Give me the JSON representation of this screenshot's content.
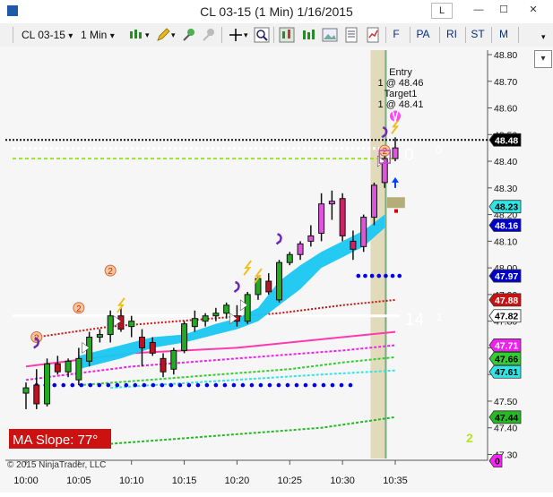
{
  "window": {
    "title": "CL 03-15 (1 Min)  1/16/2015",
    "btn_l": "L",
    "btn_min": "—",
    "btn_max": "☐",
    "btn_close": "✕"
  },
  "toolbar": {
    "instrument": "CL 03-15",
    "interval": "1 Min",
    "dropdown_glyph": "▾",
    "buttons": [
      "F",
      "PA",
      "RI",
      "ST",
      "M"
    ]
  },
  "chart": {
    "copyright": "© 2015 NinjaTrader, LLC",
    "ma_slope": "MA Slope:  77°",
    "label_14": "14",
    "label_1": "1",
    "label_0_big": "0",
    "label_0_small": "0",
    "label_2_green": "2",
    "entry_label": "Entry",
    "entry_qty": "1 @ 48.46",
    "target_label": "Target1",
    "target_qty": "1 @ 48.41",
    "circle_digit": "2",
    "axis_tick_labels": [
      "48.80",
      "48.70",
      "48.60",
      "48.50",
      "48.40",
      "48.30",
      "48.20",
      "48.10",
      "48.00",
      "47.90",
      "47.80",
      "47.70",
      "47.60",
      "47.50",
      "47.40",
      "47.30"
    ],
    "time_labels": [
      "10:00",
      "10:05",
      "10:10",
      "10:15",
      "10:20",
      "10:25",
      "10:30",
      "10:35"
    ],
    "price_badges": [
      {
        "text": "48.48",
        "bg": "#000000",
        "fg": "#ffffff"
      },
      {
        "text": "48.23",
        "bg": "#2ee6e6",
        "fg": "#000000"
      },
      {
        "text": "48.16",
        "bg": "#0000cc",
        "fg": "#ffffff"
      },
      {
        "text": "47.97",
        "bg": "#0000cc",
        "fg": "#ffffff"
      },
      {
        "text": "47.88",
        "bg": "#cc1111",
        "fg": "#ffffff"
      },
      {
        "text": "47.82",
        "bg": "#ffffff",
        "fg": "#000000"
      },
      {
        "text": "47.71",
        "bg": "#ee22ee",
        "fg": "#ffffff"
      },
      {
        "text": "47.66",
        "bg": "#33cc33",
        "fg": "#000000"
      },
      {
        "text": "47.61",
        "bg": "#2ee6e6",
        "fg": "#000000"
      },
      {
        "text": "47.44",
        "bg": "#22bb22",
        "fg": "#000000"
      },
      {
        "text": "0",
        "bg": "#ff22ff",
        "fg": "#000000"
      }
    ],
    "colors": {
      "background": "#f6f6f6",
      "up_candle": "#22aa22",
      "down_candle": "#bb1122",
      "ribbon": "#19c7f2",
      "blue_dots": "#0000ee",
      "white_line": "#ffffff",
      "ma_slope_bg": "#cc1111"
    }
  }
}
